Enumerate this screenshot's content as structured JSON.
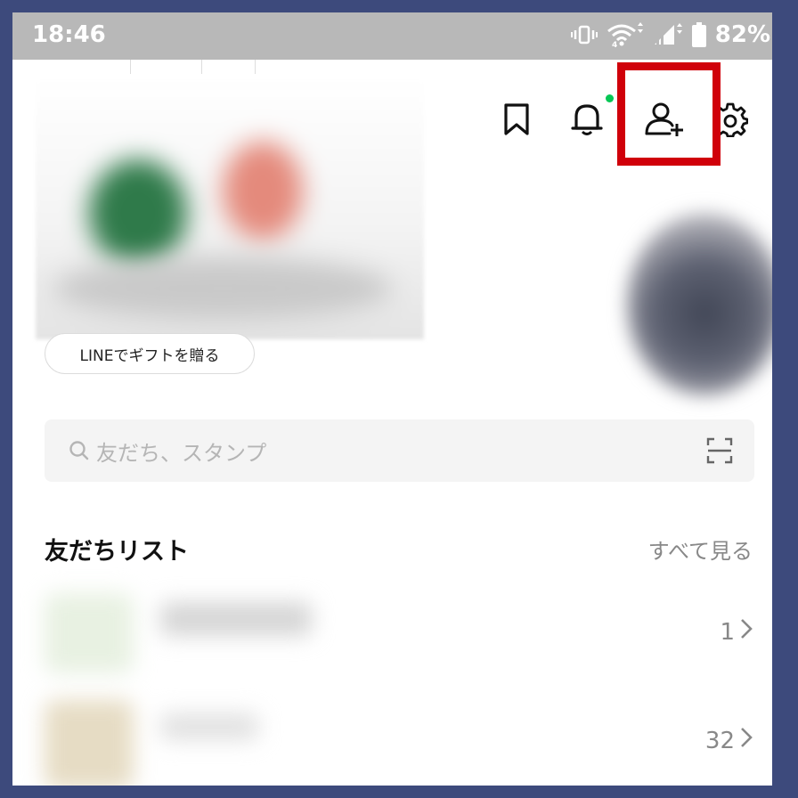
{
  "status_bar": {
    "time": "18:46",
    "network": "4",
    "battery": "82%"
  },
  "header": {
    "icons": [
      "bookmark-icon",
      "bell-icon",
      "add-friend-icon",
      "settings-icon"
    ],
    "notification_dot_color": "#06c755",
    "highlight_color": "#d0000a"
  },
  "gift_button": {
    "label": "LINEでギフトを贈る"
  },
  "search": {
    "placeholder": "友だち、スタンプ"
  },
  "friends_section": {
    "title": "友だちリスト",
    "see_all": "すべて見る",
    "rows": [
      {
        "count": "1"
      },
      {
        "count": "32"
      }
    ]
  },
  "colors": {
    "frame_border": "#3d4a7c",
    "status_bar": "#b8b8b8",
    "accent_green": "#06c755"
  }
}
